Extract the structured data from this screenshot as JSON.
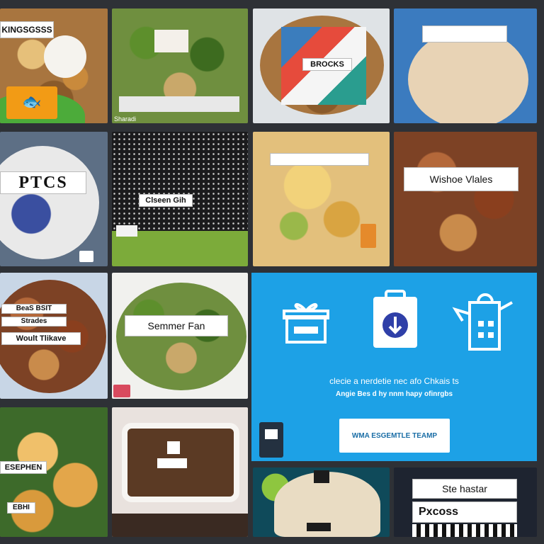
{
  "tiles": {
    "t1": {
      "label": "KINGSGSSS"
    },
    "t2": {
      "caption": "Sharadi"
    },
    "t3": {
      "label": "BROCKS"
    },
    "t5": {
      "label": "PTCS"
    },
    "t6": {
      "label": "Clseen Gih"
    },
    "t8": {
      "label": "Wishoe Vlales"
    },
    "t9": {
      "label_1": "BeaS BSIT",
      "label_2": "Strades",
      "label_3": "Woult Tlikave"
    },
    "t10": {
      "label": "Semmer Fan"
    },
    "t11": {
      "label_1": "ESEPHEN",
      "label_2": "EBHI"
    },
    "t15": {
      "label_1": "Ste hastar",
      "label_2": "Pxcoss"
    }
  },
  "promo": {
    "headline": "clecie a nerdetie nec afo Chkais ts",
    "subline": "Angie Bes d hy nnm hapy ofinrgbs",
    "button_label": "WMA ESGEMTLE TEAMP",
    "accent": "#1da1e6"
  }
}
